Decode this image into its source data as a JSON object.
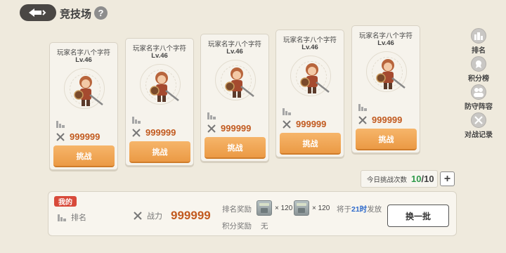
{
  "header": {
    "title": "竞技场",
    "help": "?"
  },
  "opponents": [
    {
      "name": "玩家名字八个字符",
      "level": "Lv.46",
      "power": "999999",
      "button": "挑战"
    },
    {
      "name": "玩家名字八个字符",
      "level": "Lv.46",
      "power": "999999",
      "button": "挑战"
    },
    {
      "name": "玩家名字八个字符",
      "level": "Lv.46",
      "power": "999999",
      "button": "挑战"
    },
    {
      "name": "玩家名字八个字符",
      "level": "Lv.46",
      "power": "999999",
      "button": "挑战"
    },
    {
      "name": "玩家名字八个字符",
      "level": "Lv.46",
      "power": "999999",
      "button": "挑战"
    }
  ],
  "sidebar": {
    "items": [
      {
        "label": "排名",
        "icon": "ranking-icon"
      },
      {
        "label": "积分榜",
        "icon": "points-board-icon"
      },
      {
        "label": "防守阵容",
        "icon": "defense-lineup-icon"
      },
      {
        "label": "对战记录",
        "icon": "battle-record-icon"
      }
    ]
  },
  "daily": {
    "label": "今日挑战次数",
    "count": "10",
    "total": "/10",
    "plus": "+"
  },
  "me": {
    "badge": "我的",
    "rank_label": "排名",
    "power_label": "战力",
    "power_value": "999999",
    "rank_reward_label": "排名奖励",
    "reward_1_qty": "× 120",
    "reward_2_qty": "× 120",
    "issue_prefix": "将于",
    "issue_time": "21时",
    "issue_suffix": "发放",
    "points_reward_label": "积分奖励",
    "points_reward_value": "无",
    "refresh_button": "换一批"
  },
  "colors": {
    "accent": "#eb9a45",
    "power": "#c25a1f",
    "count": "#2f9a4a",
    "badge": "#d84a3a"
  }
}
